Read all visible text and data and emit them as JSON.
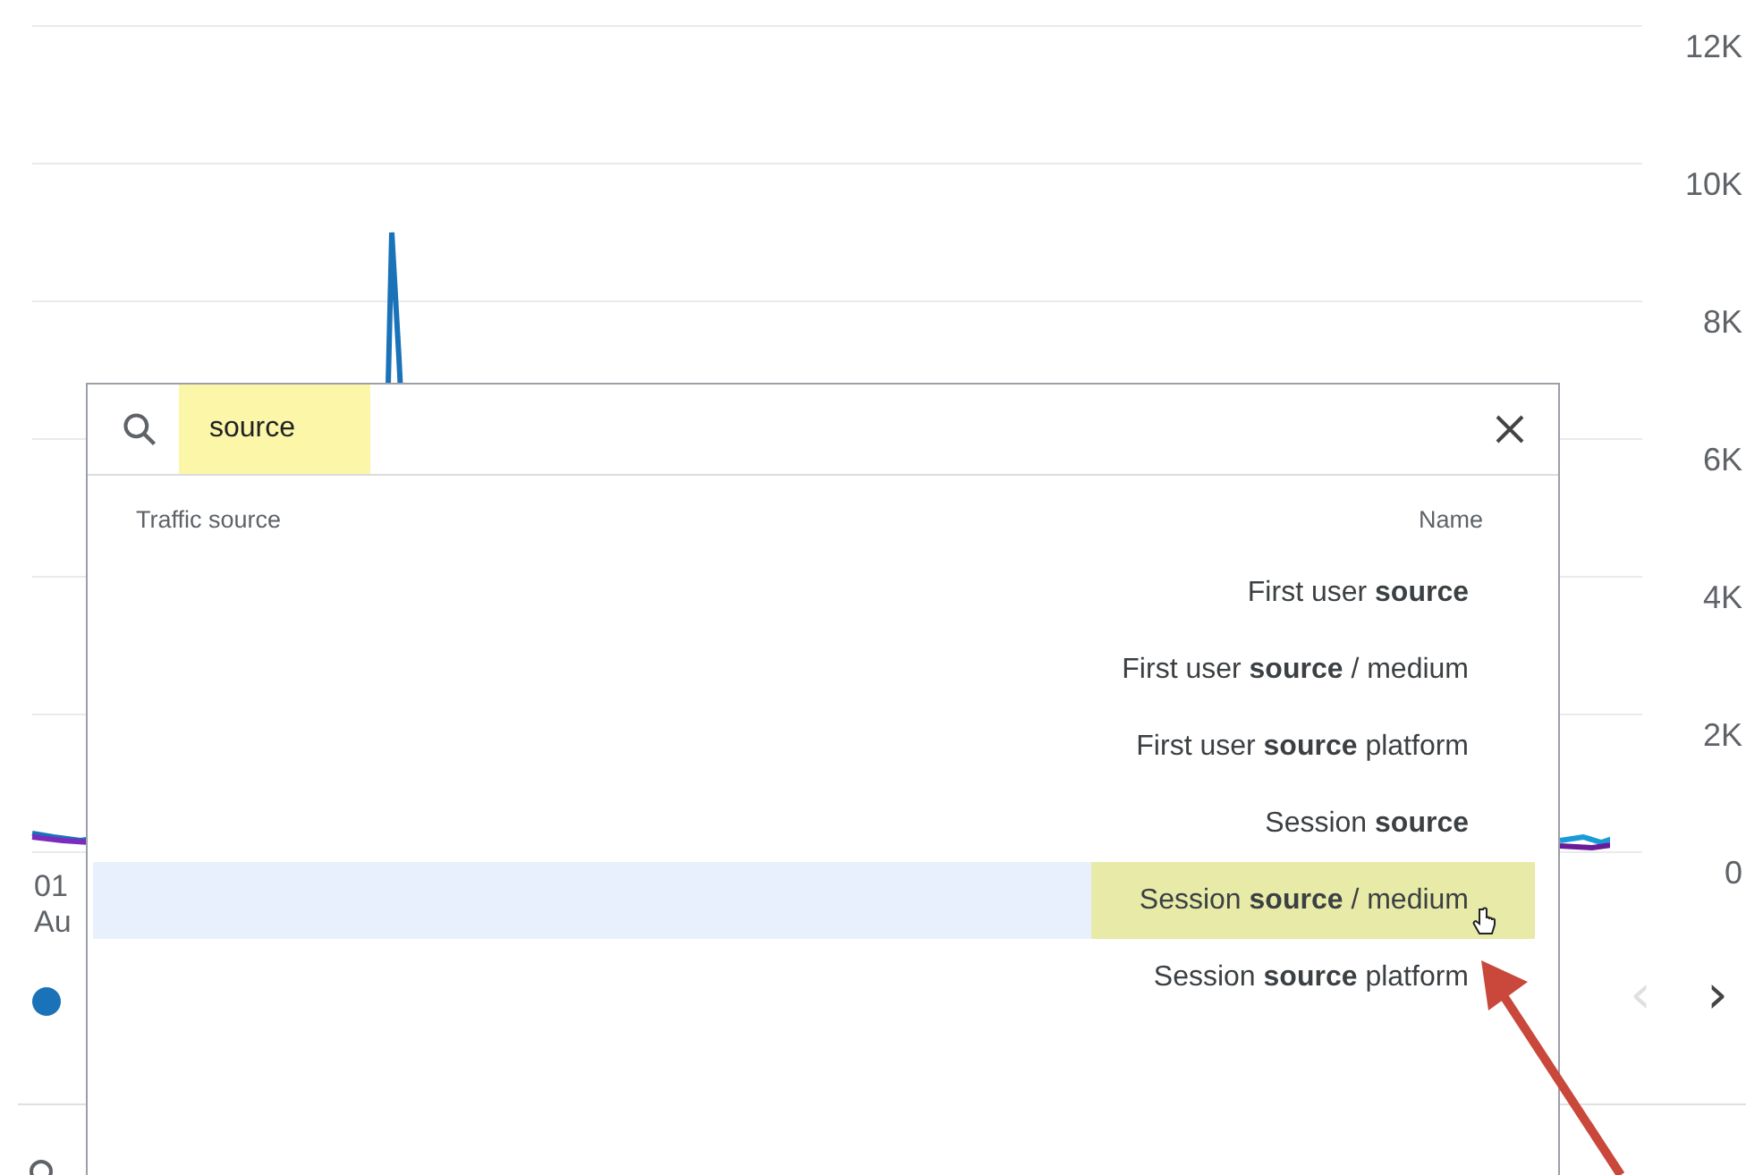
{
  "chart": {
    "y_labels": [
      "12K",
      "10K",
      "8K",
      "6K",
      "4K",
      "2K",
      "0"
    ],
    "x_label_day": "01",
    "x_label_month": "Au"
  },
  "legend": [
    {
      "color": "#1a73b8"
    }
  ],
  "pager": [
    {
      "label": "‹",
      "disabled": true
    },
    {
      "label": "›",
      "disabled": false
    }
  ],
  "search": {
    "value": "source",
    "highlighted": true
  },
  "columns": [
    "Traffic source",
    "Name"
  ],
  "items": [
    {
      "label": "First user **source**",
      "selected": false
    },
    {
      "label": "First user **source** / medium",
      "selected": false
    },
    {
      "label": "First user **source** platform",
      "selected": false
    },
    {
      "label": "Session **source**",
      "selected": false
    },
    {
      "label": "Session **source** / medium",
      "selected": true
    },
    {
      "label": "Session **source** platform",
      "selected": false
    }
  ]
}
